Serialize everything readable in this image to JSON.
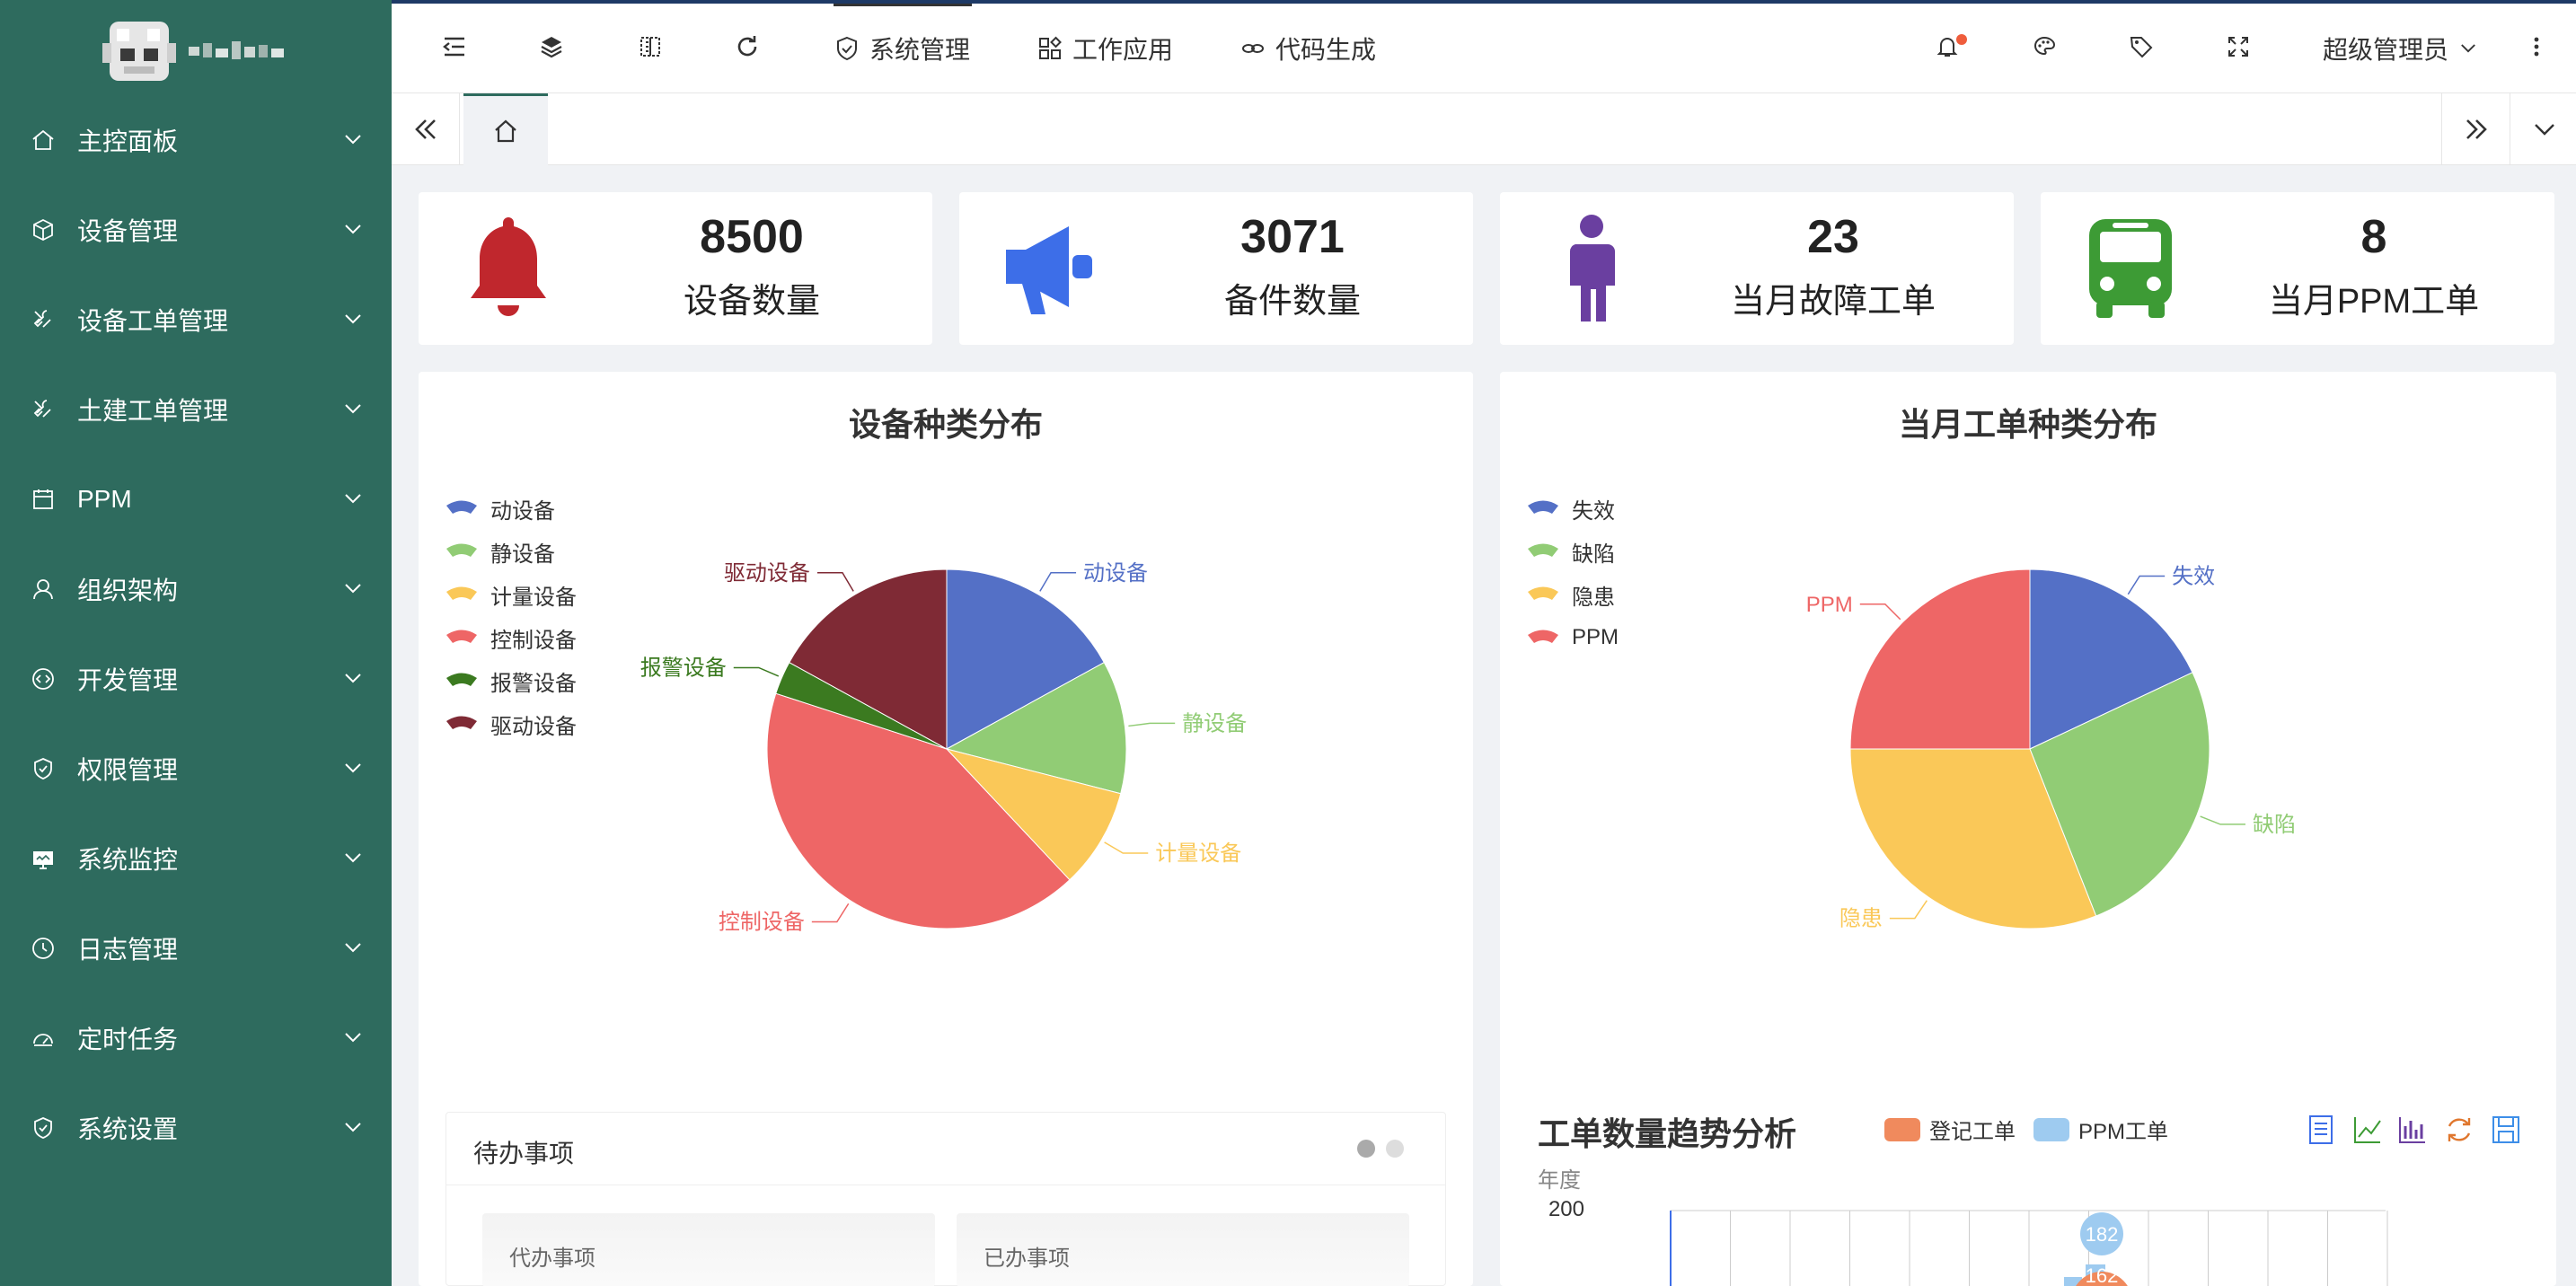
{
  "sidebar": {
    "items": [
      {
        "label": "主控面板",
        "icon": "home-icon"
      },
      {
        "label": "设备管理",
        "icon": "cube-icon"
      },
      {
        "label": "设备工单管理",
        "icon": "tools-icon"
      },
      {
        "label": "土建工单管理",
        "icon": "tools-icon"
      },
      {
        "label": "PPM",
        "icon": "calendar-icon"
      },
      {
        "label": "组织架构",
        "icon": "user-icon"
      },
      {
        "label": "开发管理",
        "icon": "code-icon"
      },
      {
        "label": "权限管理",
        "icon": "shield-icon"
      },
      {
        "label": "系统监控",
        "icon": "monitor-icon"
      },
      {
        "label": "日志管理",
        "icon": "clock-icon"
      },
      {
        "label": "定时任务",
        "icon": "dashboard-icon"
      },
      {
        "label": "系统设置",
        "icon": "shield-icon"
      }
    ]
  },
  "header": {
    "nav": {
      "system": "系统管理",
      "work": "工作应用",
      "codegen": "代码生成"
    },
    "user": "超级管理员"
  },
  "cards": [
    {
      "value": "8500",
      "label": "设备数量",
      "icon": "bell-icon",
      "color": "#c0272d"
    },
    {
      "value": "3071",
      "label": "备件数量",
      "icon": "megaphone-icon",
      "color": "#3d6ee8"
    },
    {
      "value": "23",
      "label": "当月故障工单",
      "icon": "person-icon",
      "color": "#6a3fa0"
    },
    {
      "value": "8",
      "label": "当月PPM工单",
      "icon": "bus-icon",
      "color": "#3d9b35"
    }
  ],
  "chart_data": [
    {
      "type": "pie",
      "title": "设备种类分布",
      "legend_position": "left",
      "categories": [
        "动设备",
        "静设备",
        "计量设备",
        "控制设备",
        "报警设备",
        "驱动设备"
      ],
      "values": [
        17,
        12,
        9,
        42,
        3,
        17
      ],
      "colors": [
        "#5470c6",
        "#91cc75",
        "#fac858",
        "#ee6666",
        "#3b7a20",
        "#7f2a35"
      ]
    },
    {
      "type": "pie",
      "title": "当月工单种类分布",
      "legend_position": "left",
      "categories": [
        "失效",
        "缺陷",
        "隐患",
        "PPM"
      ],
      "values": [
        18,
        26,
        31,
        25
      ],
      "colors": [
        "#5470c6",
        "#91cc75",
        "#fac858",
        "#ee6666"
      ]
    },
    {
      "type": "bar",
      "title": "工单数量趋势分析",
      "subtitle": "年度",
      "series": [
        {
          "name": "登记工单",
          "color": "#f08a5d",
          "data_labels": [
            "162"
          ]
        },
        {
          "name": "PPM工单",
          "color": "#9ecbf0",
          "data_labels": [
            "182"
          ]
        }
      ],
      "ylabels": [
        "200"
      ]
    }
  ],
  "todo": {
    "title": "待办事项",
    "pending": "代办事项",
    "done": "已办事项"
  }
}
